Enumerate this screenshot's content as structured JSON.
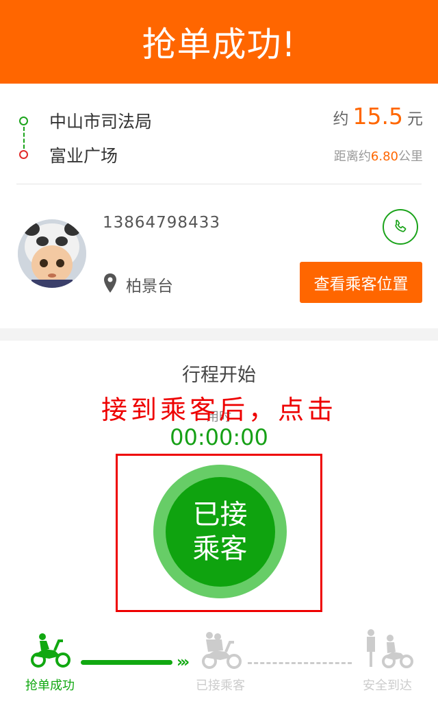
{
  "header": {
    "title": "抢单成功!"
  },
  "route": {
    "start": "中山市司法局",
    "end": "富业广场",
    "price_prefix": "约",
    "price": "15.5",
    "price_unit": "元",
    "distance_prefix": "距离约",
    "distance": "6.80",
    "distance_unit": "公里"
  },
  "passenger": {
    "phone": "13864798433",
    "pickup": "柏景台",
    "view_location_button": "查看乘客位置"
  },
  "trip": {
    "status": "行程开始",
    "annotation": "接到乘客后，点击",
    "duration_label": "用时",
    "timer": "00:00:00",
    "button_line1": "已接",
    "button_line2": "乘客"
  },
  "steps": [
    {
      "label": "抢单成功",
      "state": "done"
    },
    {
      "label": "已接乘客",
      "state": "pending"
    },
    {
      "label": "安全到达",
      "state": "pending"
    }
  ],
  "colors": {
    "brand": "#ff6600",
    "green": "#11a811",
    "annotation_red": "#ee0000",
    "inactive": "#cccccc"
  }
}
